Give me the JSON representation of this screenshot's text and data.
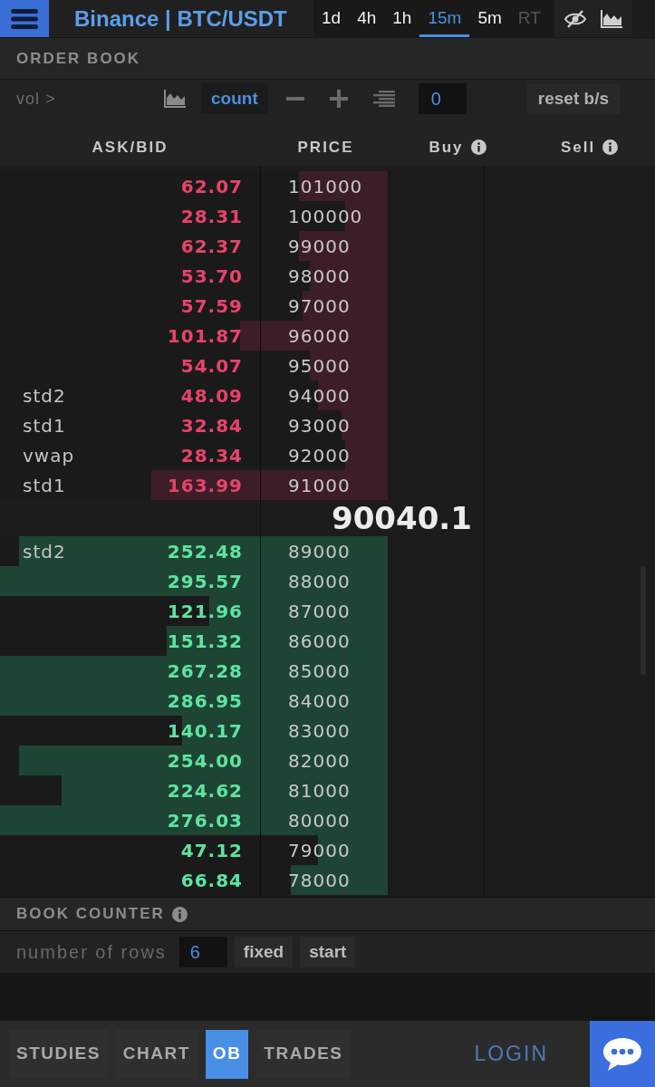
{
  "header": {
    "title": "Binance | BTC/USDT",
    "timeframes": [
      {
        "label": "1d",
        "selected": false,
        "disabled": false
      },
      {
        "label": "4h",
        "selected": false,
        "disabled": false
      },
      {
        "label": "1h",
        "selected": false,
        "disabled": false
      },
      {
        "label": "15m",
        "selected": true,
        "disabled": false
      },
      {
        "label": "5m",
        "selected": false,
        "disabled": false
      },
      {
        "label": "RT",
        "selected": false,
        "disabled": true
      }
    ]
  },
  "order_book": {
    "title": "ORDER BOOK",
    "toolbar": {
      "vol_label": "vol >",
      "count": {
        "label": "count",
        "active": true
      },
      "step_value": "0",
      "reset_label": "reset b/s"
    },
    "columns": [
      {
        "label": "ASK/BID",
        "info": false
      },
      {
        "label": "PRICE",
        "info": false
      },
      {
        "label": "Buy",
        "info": true
      },
      {
        "label": "Sell",
        "info": true
      }
    ],
    "asks": [
      {
        "size": "62.07",
        "price": "101000",
        "level": 0.23
      },
      {
        "size": "28.31",
        "price": "100000",
        "level": 0.11
      },
      {
        "size": "62.37",
        "price": "99000",
        "level": 0.23
      },
      {
        "size": "53.70",
        "price": "98000",
        "level": 0.2
      },
      {
        "size": "57.59",
        "price": "97000",
        "level": 0.22
      },
      {
        "size": "101.87",
        "price": "96000",
        "level": 0.38
      },
      {
        "size": "54.07",
        "price": "95000",
        "level": 0.2
      },
      {
        "study": "std2",
        "size": "48.09",
        "price": "94000",
        "level": 0.18
      },
      {
        "study": "std1",
        "size": "32.84",
        "price": "93000",
        "level": 0.12
      },
      {
        "study": "vwap",
        "size": "28.34",
        "price": "92000",
        "level": 0.11
      },
      {
        "study": "std1",
        "size": "163.99",
        "price": "91000",
        "level": 0.61
      }
    ],
    "last_price": "90040.1",
    "bids": [
      {
        "study": "std2",
        "size": "252.48",
        "price": "89000",
        "level": 0.95
      },
      {
        "size": "295.57",
        "price": "88000",
        "level": 1
      },
      {
        "size": "121.96",
        "price": "87000",
        "level": 0.46
      },
      {
        "size": "151.32",
        "price": "86000",
        "level": 0.57
      },
      {
        "size": "267.28",
        "price": "85000",
        "level": 1
      },
      {
        "size": "286.95",
        "price": "84000",
        "level": 1
      },
      {
        "size": "140.17",
        "price": "83000",
        "level": 0.53
      },
      {
        "size": "254.00",
        "price": "82000",
        "level": 0.95
      },
      {
        "size": "224.62",
        "price": "81000",
        "level": 0.84
      },
      {
        "size": "276.03",
        "price": "80000",
        "level": 1
      },
      {
        "size": "47.12",
        "price": "79000",
        "level": 0.18
      },
      {
        "size": "66.84",
        "price": "78000",
        "level": 0.25
      }
    ]
  },
  "book_counter": {
    "title": "BOOK COUNTER",
    "info": true,
    "rows_label": "number of rows",
    "rows_value": "6",
    "buttons": [
      "fixed",
      "start"
    ]
  },
  "bottom_nav": {
    "tabs": [
      {
        "label": "STUDIES",
        "selected": false
      },
      {
        "label": "CHART",
        "selected": false
      },
      {
        "label": "OB",
        "selected": true
      },
      {
        "label": "TRADES",
        "selected": false
      }
    ],
    "login": "LOGIN"
  }
}
